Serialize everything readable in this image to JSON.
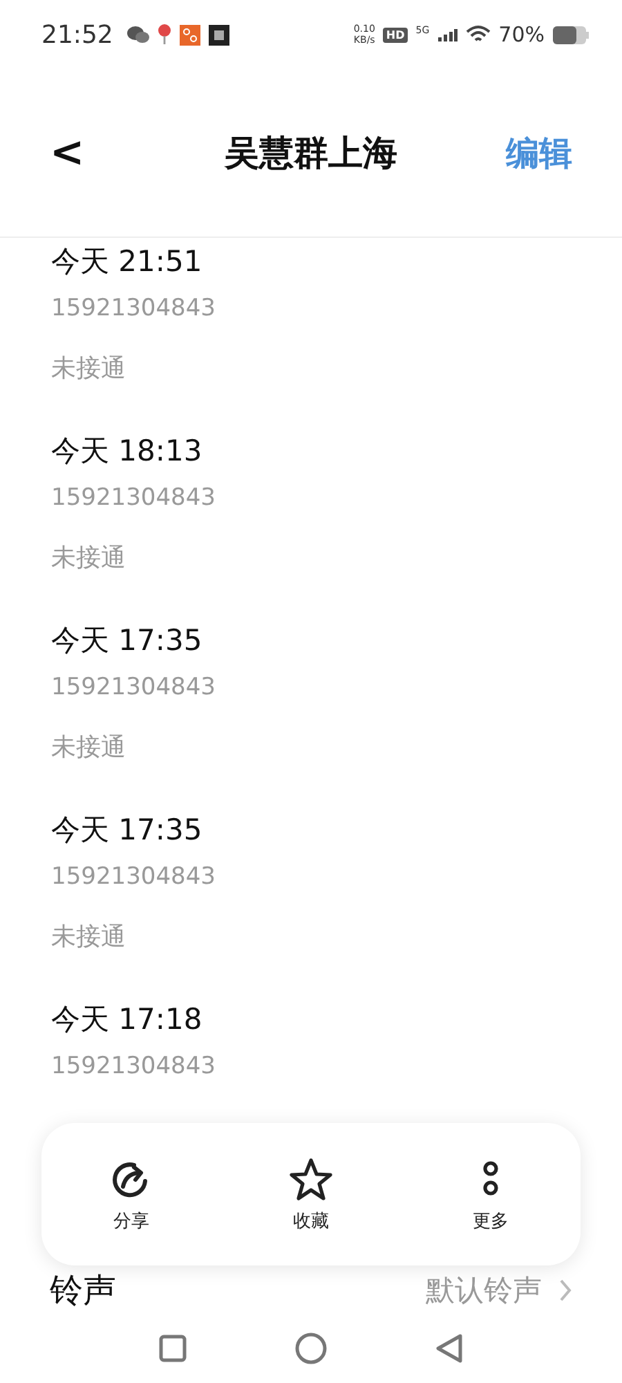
{
  "status_bar": {
    "time": "21:52",
    "net_speed_value": "0.10",
    "net_speed_unit": "KB/s",
    "hd": "HD",
    "network": "5G",
    "battery": "70%"
  },
  "header": {
    "back": "<",
    "title": "吴慧群上海",
    "action": "编辑"
  },
  "calls": [
    {
      "time": "今天 21:51",
      "number": "15921304843",
      "status": "未接通"
    },
    {
      "time": "今天 18:13",
      "number": "15921304843",
      "status": "未接通"
    },
    {
      "time": "今天 17:35",
      "number": "15921304843",
      "status": "未接通"
    },
    {
      "time": "今天 17:35",
      "number": "15921304843",
      "status": "未接通"
    },
    {
      "time": "今天 17:18",
      "number": "15921304843"
    }
  ],
  "actions": [
    {
      "kind": "share",
      "label": "分享"
    },
    {
      "kind": "star",
      "label": "收藏"
    },
    {
      "kind": "more",
      "label": "更多"
    }
  ],
  "ringtone": {
    "label": "铃声",
    "value": "默认铃声"
  }
}
